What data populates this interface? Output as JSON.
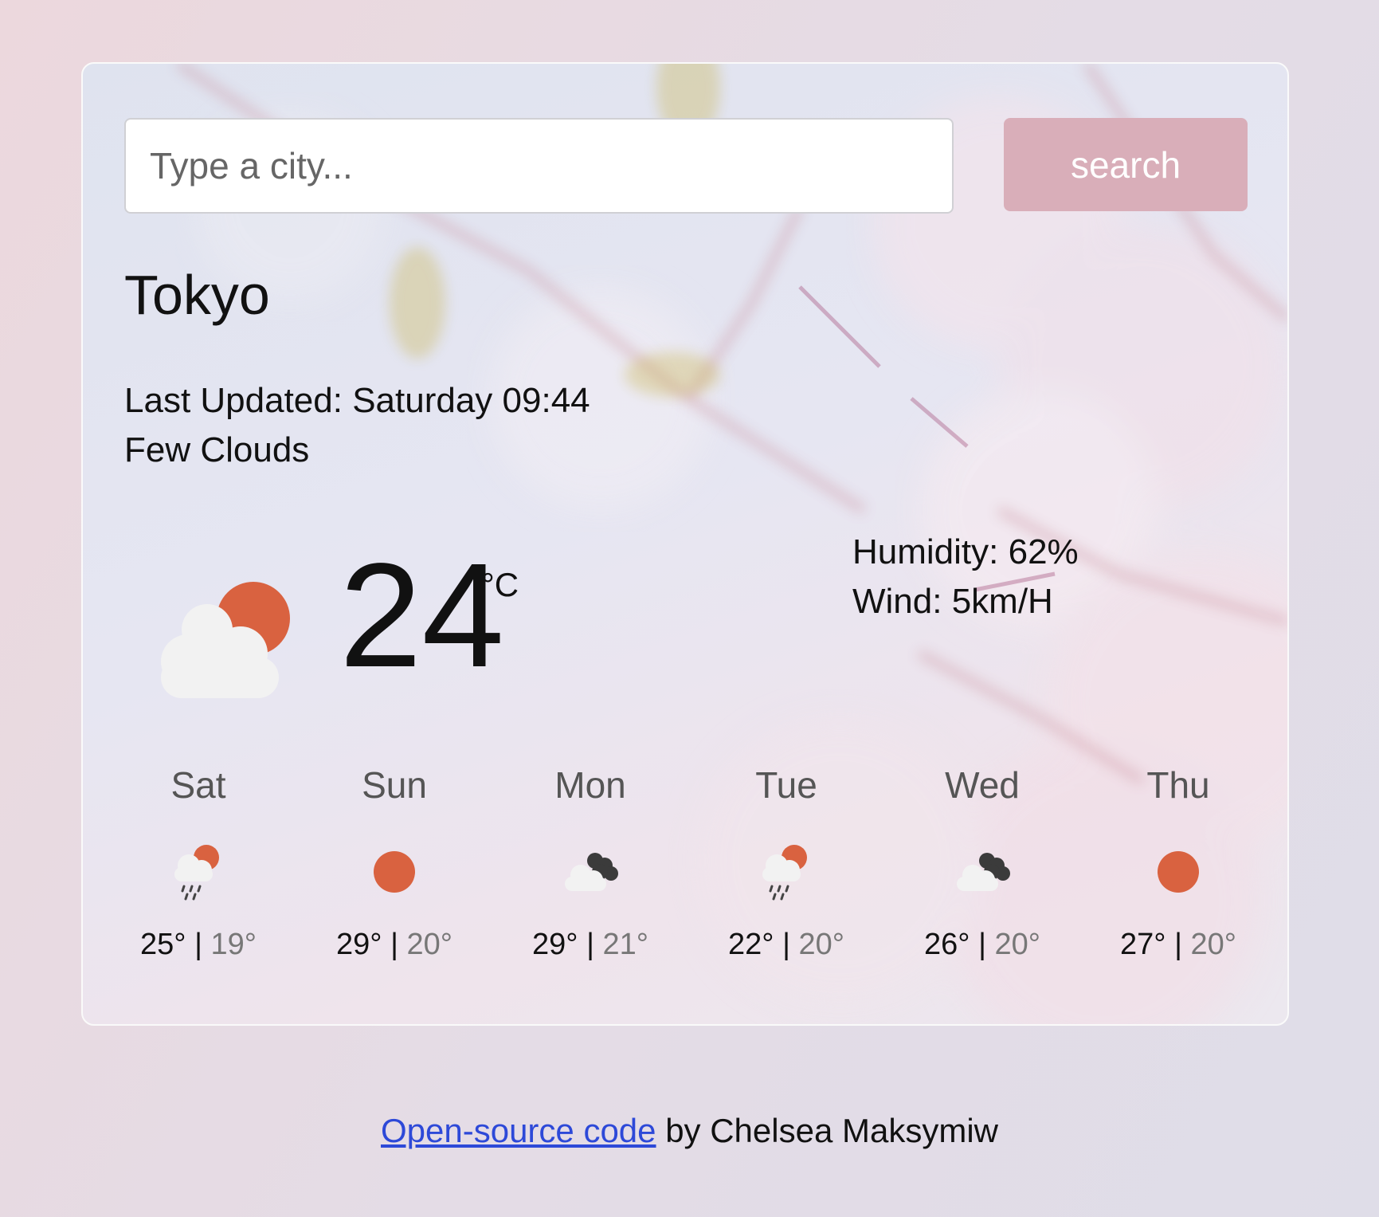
{
  "search": {
    "placeholder": "Type a city...",
    "button_label": "search"
  },
  "city": "Tokyo",
  "last_updated": "Last Updated: Saturday 09:44",
  "description": "Few Clouds",
  "current": {
    "temperature": "24",
    "unit": "°C",
    "humidity": "Humidity: 62%",
    "wind": "Wind: 5km/H",
    "icon": "partly-cloudy-icon"
  },
  "forecast": [
    {
      "day": "Sat",
      "max": "25°",
      "sep": "|",
      "min": "19°",
      "icon": "rain-sun-icon"
    },
    {
      "day": "Sun",
      "max": "29°",
      "sep": "|",
      "min": "20°",
      "icon": "sun-icon"
    },
    {
      "day": "Mon",
      "max": "29°",
      "sep": "|",
      "min": "21°",
      "icon": "dark-cloud-icon"
    },
    {
      "day": "Tue",
      "max": "22°",
      "sep": "|",
      "min": "20°",
      "icon": "rain-sun-icon"
    },
    {
      "day": "Wed",
      "max": "26°",
      "sep": "|",
      "min": "20°",
      "icon": "dark-cloud-icon"
    },
    {
      "day": "Thu",
      "max": "27°",
      "sep": "|",
      "min": "20°",
      "icon": "sun-icon"
    }
  ],
  "footer": {
    "link_text": "Open-source code",
    "suffix": " by Chelsea Maksymiw"
  },
  "colors": {
    "accent_button": "#d9aeb9",
    "sun": "#d96240",
    "cloud": "#f2f2f2",
    "dark_cloud": "#3b3b3b",
    "link": "#2d49d8"
  }
}
